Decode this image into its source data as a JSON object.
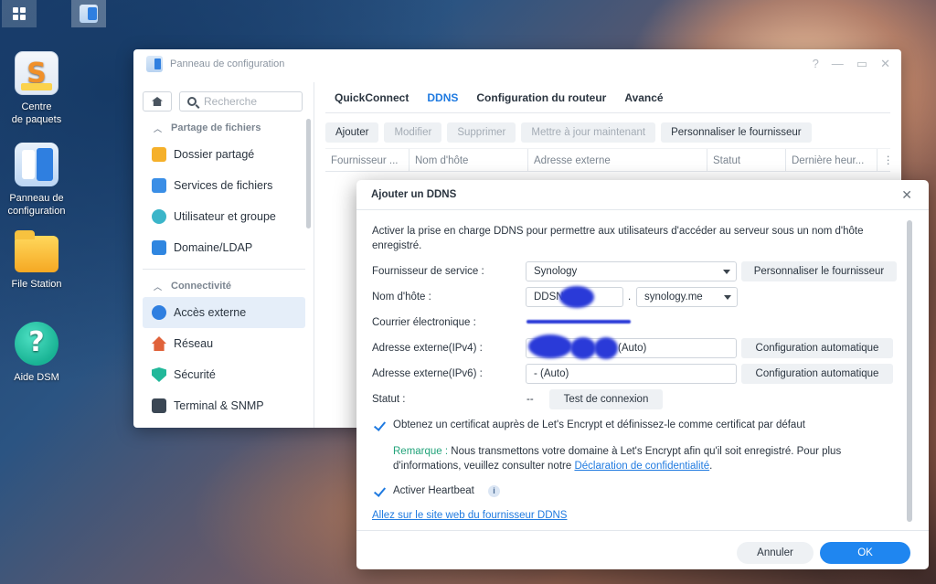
{
  "desktop": {
    "icons": [
      {
        "label_line1": "Centre",
        "label_line2": "de paquets",
        "icon": "package-center-icon"
      },
      {
        "label_line1": "Panneau de",
        "label_line2": "configuration",
        "icon": "control-panel-icon"
      },
      {
        "label_line1": "File Station",
        "label_line2": "",
        "icon": "file-station-icon"
      },
      {
        "label_line1": "Aide DSM",
        "label_line2": "",
        "icon": "dsm-help-icon"
      }
    ]
  },
  "control_panel": {
    "title": "Panneau de configuration",
    "window_controls": [
      "?",
      "—",
      "▭",
      "✕"
    ],
    "search": {
      "placeholder": "Recherche"
    },
    "sidebar": {
      "sections": [
        {
          "title": "Partage de fichiers",
          "items": [
            "Dossier partagé",
            "Services de fichiers",
            "Utilisateur et groupe",
            "Domaine/LDAP"
          ]
        },
        {
          "title": "Connectivité",
          "items": [
            "Accès externe",
            "Réseau",
            "Sécurité",
            "Terminal & SNMP"
          ]
        }
      ],
      "active_item": "Accès externe"
    },
    "tabs": [
      "QuickConnect",
      "DDNS",
      "Configuration du routeur",
      "Avancé"
    ],
    "active_tab": "DDNS",
    "toolbar": {
      "add": "Ajouter",
      "modify": "Modifier",
      "delete": "Supprimer",
      "update_now": "Mettre à jour maintenant",
      "customize_provider": "Personnaliser le fournisseur"
    },
    "table_columns": [
      "Fournisseur ...",
      "Nom d'hôte",
      "Adresse externe",
      "Statut",
      "Dernière heur..."
    ]
  },
  "dialog": {
    "title": "Ajouter un DDNS",
    "close": "✕",
    "intro": "Activer la prise en charge DDNS pour permettre aux utilisateurs d'accéder au serveur sous un nom d'hôte enregistré.",
    "fields": {
      "provider_label": "Fournisseur de service :",
      "provider_value": "Synology",
      "customize_provider_btn": "Personnaliser le fournisseur",
      "hostname_label": "Nom d'hôte :",
      "hostname_value": "DDSN",
      "hostname_dot": ".",
      "domain_value": "synology.me",
      "email_label": "Courrier électronique :",
      "ipv4_label": "Adresse externe(IPv4) :",
      "ipv4_value": "(Auto)",
      "ipv6_label": "Adresse externe(IPv6) :",
      "ipv6_value": "- (Auto)",
      "auto_config_btn": "Configuration automatique",
      "status_label": "Statut :",
      "status_value": "--",
      "test_connection_btn": "Test de connexion"
    },
    "letsencrypt": {
      "checked": true,
      "label": "Obtenez un certificat auprès de Let's Encrypt et définissez-le comme certificat par défaut"
    },
    "note": {
      "label": "Remarque :",
      "text": "Nous transmettons votre domaine à Let's Encrypt afin qu'il soit enregistré. Pour plus d'informations, veuillez consulter notre",
      "link": "Déclaration de confidentialité",
      "end": "."
    },
    "heartbeat": {
      "checked": true,
      "label": "Activer Heartbeat",
      "info": "i"
    },
    "provider_site_link": "Allez sur le site web du fournisseur DDNS",
    "buttons": {
      "cancel": "Annuler",
      "ok": "OK"
    },
    "colors": {
      "accent": "#1f86f0",
      "note_green": "#22a37a",
      "link": "#1f7ae0"
    }
  }
}
